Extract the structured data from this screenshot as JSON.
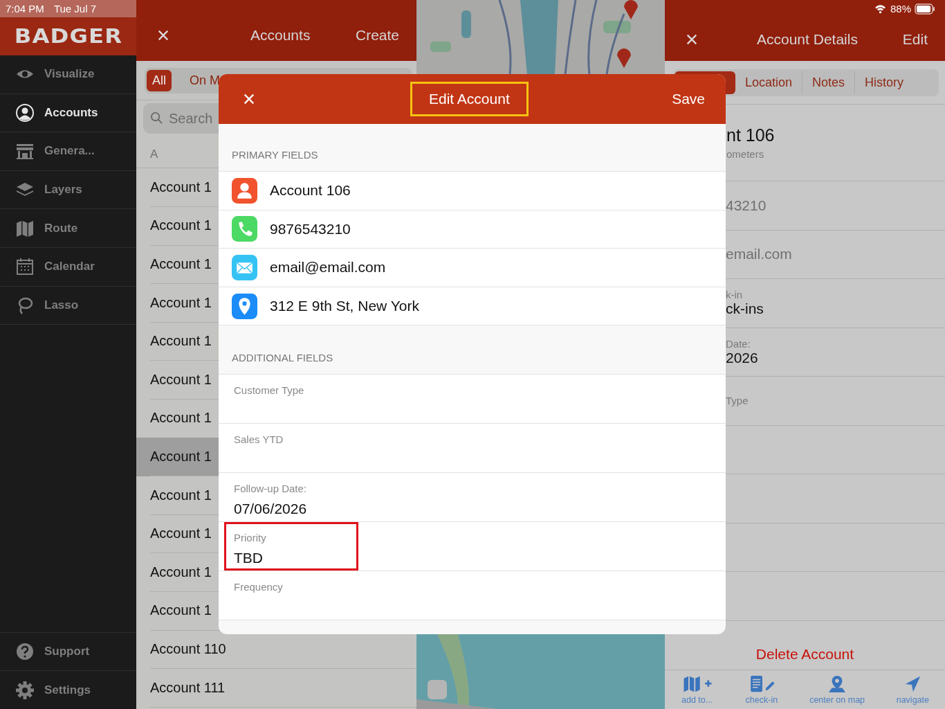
{
  "status_bar": {
    "time": "7:04 PM",
    "date": "Tue Jul 7",
    "battery": "88%"
  },
  "sidebar": {
    "logo": "BADGER",
    "items": [
      {
        "kind": "eye",
        "label": "Visualize",
        "selected": false
      },
      {
        "kind": "person",
        "label": "Accounts",
        "selected": true
      },
      {
        "kind": "store",
        "label": "Genera...",
        "selected": false
      },
      {
        "kind": "layers",
        "label": "Layers",
        "selected": false
      },
      {
        "kind": "map",
        "label": "Route",
        "selected": false
      },
      {
        "kind": "calendar",
        "label": "Calendar",
        "selected": false
      },
      {
        "kind": "lasso",
        "label": "Lasso",
        "selected": false
      }
    ],
    "bottom_items": [
      {
        "kind": "help",
        "label": "Support",
        "selected": false
      },
      {
        "kind": "gear",
        "label": "Settings",
        "selected": false
      }
    ]
  },
  "accounts": {
    "title": "Accounts",
    "action": "Create",
    "filters": [
      {
        "label": "All",
        "selected": true
      },
      {
        "label": "On M",
        "selected": false
      }
    ],
    "search": {
      "placeholder": "Search"
    },
    "section": "A",
    "rows": [
      {
        "name": "Account 1",
        "selected": false
      },
      {
        "name": "Account 1",
        "selected": false
      },
      {
        "name": "Account 1",
        "selected": false
      },
      {
        "name": "Account 1",
        "selected": false
      },
      {
        "name": "Account 1",
        "selected": false
      },
      {
        "name": "Account 1",
        "selected": false
      },
      {
        "name": "Account 1",
        "selected": false
      },
      {
        "name": "Account 1",
        "selected": true
      },
      {
        "name": "Account 1",
        "selected": false
      },
      {
        "name": "Account 1",
        "selected": false
      },
      {
        "name": "Account 1",
        "selected": false
      },
      {
        "name": "Account 1",
        "selected": false
      },
      {
        "name": "Account 110",
        "selected": false
      },
      {
        "name": "Account 111",
        "selected": false
      }
    ]
  },
  "details": {
    "title": "Account Details",
    "action": "Edit",
    "tabs": [
      {
        "selected": true
      },
      {
        "label": "Location",
        "selected": false
      },
      {
        "label": "Notes",
        "selected": false
      },
      {
        "label": "History",
        "selected": false
      }
    ],
    "name": "nt 106",
    "distance": "ometers",
    "rows": [
      {
        "value": "43210"
      },
      {
        "value": "email.com"
      },
      {
        "label": "k-in",
        "value": "ck-ins"
      },
      {
        "label": "Date:",
        "value": "2026"
      },
      {
        "label": "Type"
      },
      {},
      {},
      {},
      {}
    ],
    "delete": "Delete Account",
    "toolbar": [
      {
        "kind": "add",
        "label": "add to..."
      },
      {
        "kind": "checkin",
        "label": "check-in"
      },
      {
        "kind": "center",
        "label": "center on map"
      },
      {
        "kind": "navigate",
        "label": "navigate"
      }
    ]
  },
  "modal": {
    "title": "Edit Account",
    "title_highlighted": true,
    "save": "Save",
    "primary_header": "PRIMARY FIELDS",
    "primary": [
      {
        "kind": "person",
        "value": "Account 106"
      },
      {
        "kind": "phone",
        "value": "9876543210"
      },
      {
        "kind": "mail",
        "value": "email@email.com"
      },
      {
        "kind": "pin",
        "value": "312 E 9th St, New York"
      }
    ],
    "additional_header": "ADDITIONAL FIELDS",
    "additional": [
      {
        "label": "Customer Type",
        "highlighted": false
      },
      {
        "label": "Sales YTD",
        "highlighted": false
      },
      {
        "label": "Follow-up Date:",
        "value": "07/06/2026",
        "highlighted": false
      },
      {
        "label": "Priority",
        "value": "TBD",
        "highlighted": true
      },
      {
        "label": "Frequency",
        "highlighted": false
      }
    ]
  }
}
